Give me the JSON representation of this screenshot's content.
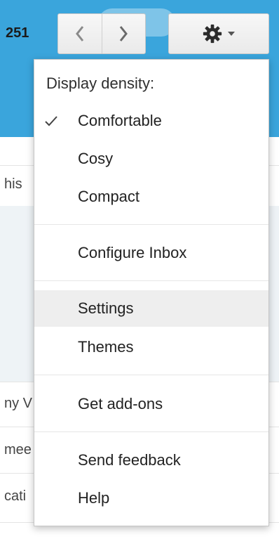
{
  "header": {
    "page_count": "251",
    "nav_prev_icon": "chevron-left-icon",
    "nav_next_icon": "chevron-right-icon",
    "settings_icon": "gear-icon",
    "settings_caret_icon": "caret-down-icon",
    "band_color": "#3aa5dc"
  },
  "background_list": {
    "row_snippets": [
      "his",
      "ny V",
      "mee",
      "cati"
    ]
  },
  "menu": {
    "heading": "Display density:",
    "density_options": [
      {
        "label": "Comfortable",
        "selected": true
      },
      {
        "label": "Cosy",
        "selected": false
      },
      {
        "label": "Compact",
        "selected": false
      }
    ],
    "configure_inbox": "Configure Inbox",
    "settings": "Settings",
    "themes": "Themes",
    "get_addons": "Get add-ons",
    "send_feedback": "Send feedback",
    "help": "Help",
    "highlighted_item": "Settings"
  }
}
